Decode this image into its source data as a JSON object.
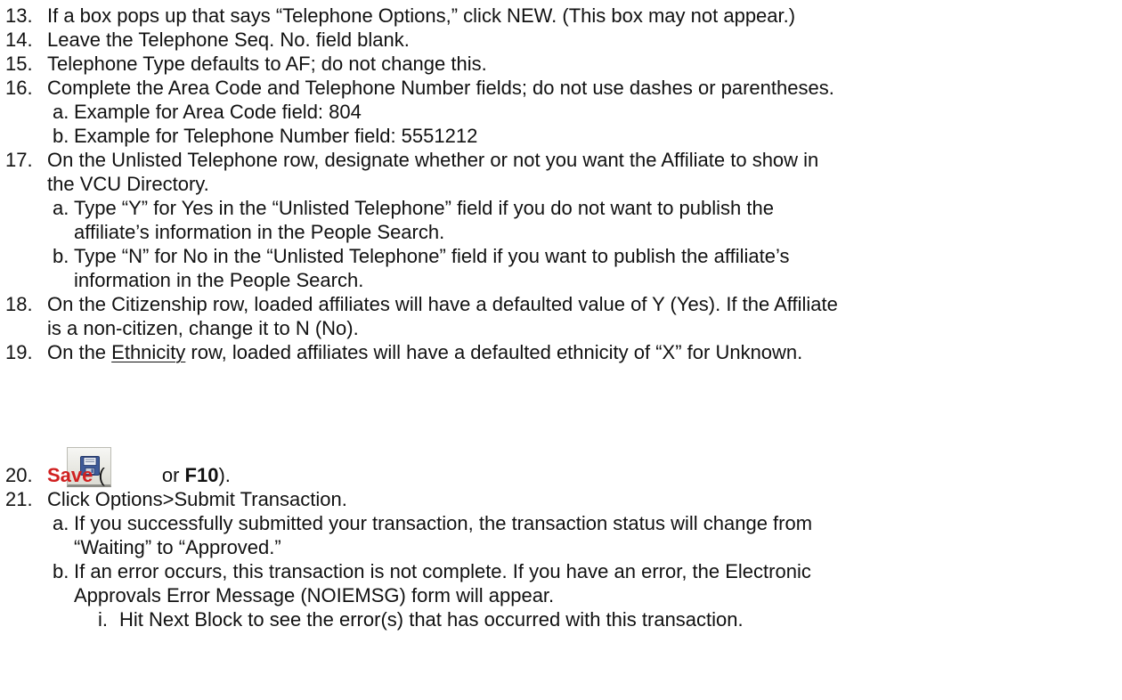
{
  "steps": [
    {
      "num": "13.",
      "text": "If a box pops up that says “Telephone Options,” click NEW. (This box may not appear.)"
    },
    {
      "num": "14.",
      "text": "Leave the Telephone Seq. No. field blank."
    },
    {
      "num": "15.",
      "text": "Telephone Type defaults to AF; do not change this."
    },
    {
      "num": "16.",
      "text": "Complete the Area Code and Telephone Number fields; do not use dashes or parentheses."
    },
    {
      "num": "a.",
      "text": "Example for Area Code field:  804"
    },
    {
      "num": "b.",
      "text": "Example for Telephone Number field: 5551212"
    },
    {
      "num": "17.",
      "text": "On the Unlisted Telephone row, designate whether or not you want the Affiliate to show in",
      "cont": "the VCU Directory."
    },
    {
      "num": "a.",
      "text": "Type “Y” for Yes in the “Unlisted Telephone” field if you do not want to publish the",
      "cont": "affiliate’s information in the People Search."
    },
    {
      "num": "b.",
      "text": "Type “N” for No in the “Unlisted Telephone” field if you want to publish the affiliate’s",
      "cont": "information in the People Search."
    },
    {
      "num": "18.",
      "text": "On the Citizenship row, loaded affiliates will have a defaulted value of Y (Yes). If the Affiliate",
      "cont": "is a non-citizen, change it to N (No)."
    },
    {
      "num": "19.",
      "text_before": "On the ",
      "text_underlined": "Ethnicity",
      "text_after": " row, loaded affiliates will have a defaulted ethnicity of “X” for Unknown."
    },
    {
      "num": "20.",
      "save_label": "Save",
      "open_paren": "(",
      "or_text": "or",
      "key": "F10",
      "close_text": ")."
    },
    {
      "num": "21.",
      "text": "Click Options>Submit Transaction."
    },
    {
      "num": "a.",
      "text": "If you successfully submitted your transaction, the transaction status will change from",
      "cont": "“Waiting” to “Approved.”"
    },
    {
      "num": "b.",
      "text": "If an error occurs, this transaction is not complete. If you have an error, the Electronic",
      "cont": "Approvals Error Message (NOIEMSG) form will appear."
    },
    {
      "num": "i.",
      "text": "Hit Next Block to see the error(s) that has occurred with this transaction."
    }
  ],
  "icons": {
    "save": "floppy-disk-save-icon"
  },
  "colors": {
    "save_label": "#d02020",
    "text": "#111111"
  }
}
